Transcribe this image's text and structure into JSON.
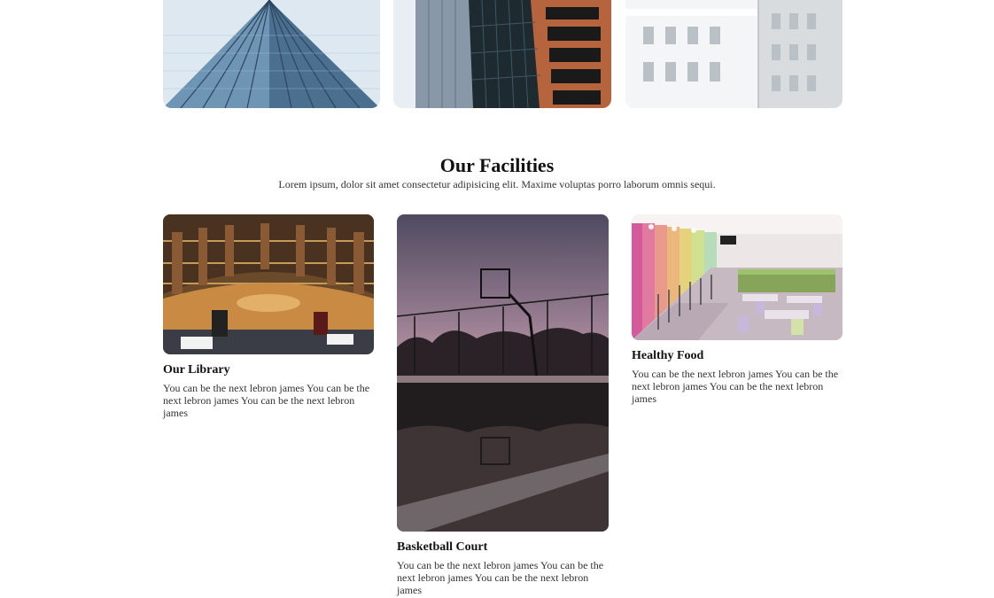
{
  "gallery": {
    "images": [
      {
        "name": "glass-skyscraper-photo"
      },
      {
        "name": "dark-tower-photo"
      },
      {
        "name": "white-building-photo"
      }
    ]
  },
  "facilities": {
    "title": "Our Facilities",
    "subtitle": "Lorem ipsum, dolor sit amet consectetur adipisicing elit. Maxime voluptas porro laborum omnis sequi.",
    "cards": [
      {
        "title": "Our Library",
        "text": "You can be the next lebron james You can be the next lebron james You can be the next lebron james"
      },
      {
        "title": "Basketball Court",
        "text": "You can be the next lebron james You can be the next lebron james You can be the next lebron james"
      },
      {
        "title": "Healthy Food",
        "text": "You can be the next lebron james You can be the next lebron james You can be the next lebron james"
      }
    ]
  }
}
